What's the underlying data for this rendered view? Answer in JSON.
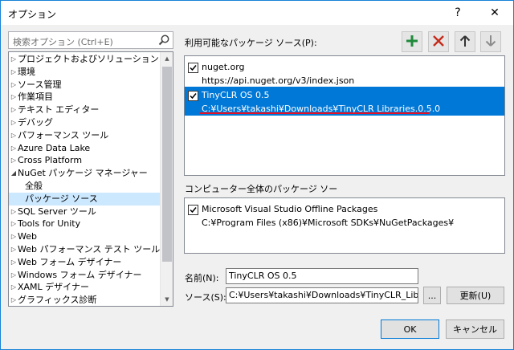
{
  "window": {
    "title": "オプション",
    "help_glyph": "?",
    "close_glyph": "✕"
  },
  "search": {
    "placeholder": "検索オプション (Ctrl+E)"
  },
  "tree": {
    "items": [
      {
        "label": "プロジェクトおよびソリューション",
        "arrow": "▷",
        "child": false,
        "selected": false
      },
      {
        "label": "環境",
        "arrow": "▷",
        "child": false,
        "selected": false
      },
      {
        "label": "ソース管理",
        "arrow": "▷",
        "child": false,
        "selected": false
      },
      {
        "label": "作業項目",
        "arrow": "▷",
        "child": false,
        "selected": false
      },
      {
        "label": "テキスト エディター",
        "arrow": "▷",
        "child": false,
        "selected": false
      },
      {
        "label": "デバッグ",
        "arrow": "▷",
        "child": false,
        "selected": false
      },
      {
        "label": "パフォーマンス ツール",
        "arrow": "▷",
        "child": false,
        "selected": false
      },
      {
        "label": "Azure Data Lake",
        "arrow": "▷",
        "child": false,
        "selected": false
      },
      {
        "label": "Cross Platform",
        "arrow": "▷",
        "child": false,
        "selected": false
      },
      {
        "label": "NuGet パッケージ マネージャー",
        "arrow": "◢",
        "child": false,
        "selected": false
      },
      {
        "label": "全般",
        "arrow": "",
        "child": true,
        "selected": false
      },
      {
        "label": "パッケージ ソース",
        "arrow": "",
        "child": true,
        "selected": true
      },
      {
        "label": "SQL Server ツール",
        "arrow": "▷",
        "child": false,
        "selected": false
      },
      {
        "label": "Tools for Unity",
        "arrow": "▷",
        "child": false,
        "selected": false
      },
      {
        "label": "Web",
        "arrow": "▷",
        "child": false,
        "selected": false
      },
      {
        "label": "Web パフォーマンス テスト ツール",
        "arrow": "▷",
        "child": false,
        "selected": false
      },
      {
        "label": "Web フォーム デザイナー",
        "arrow": "▷",
        "child": false,
        "selected": false
      },
      {
        "label": "Windows フォーム デザイナー",
        "arrow": "▷",
        "child": false,
        "selected": false
      },
      {
        "label": "XAML デザイナー",
        "arrow": "▷",
        "child": false,
        "selected": false
      },
      {
        "label": "グラフィックス診断",
        "arrow": "▷",
        "child": false,
        "selected": false
      }
    ]
  },
  "sources": {
    "label": "利用可能なパッケージ ソース(P):",
    "toolbar": {
      "add_icon": "plus-icon",
      "remove_icon": "x-icon",
      "up_icon": "arrow-up-icon",
      "down_icon": "arrow-down-icon",
      "add_color": "#1f8a3b",
      "remove_color": "#c42b1c"
    },
    "items": [
      {
        "name": "nuget.org",
        "url": "https://api.nuget.org/v3/index.json",
        "checked": true,
        "selected": false
      },
      {
        "name": "TinyCLR OS 0.5",
        "url": "C:¥Users¥takashi¥Downloads¥TinyCLR Libraries.0.5.0",
        "checked": true,
        "selected": true
      }
    ]
  },
  "machine_sources": {
    "label": "コンピューター全体のパッケージ ソー",
    "items": [
      {
        "name": "Microsoft Visual Studio Offline Packages",
        "url": "C:¥Program Files (x86)¥Microsoft SDKs¥NuGetPackages¥",
        "checked": true
      }
    ]
  },
  "form": {
    "name_label": "名前(N):",
    "name_value": "TinyCLR OS 0.5",
    "source_label": "ソース(S):",
    "source_value": "C:¥Users¥takashi¥Downloads¥TinyCLR_Librar",
    "browse_label": "...",
    "update_label": "更新(U)"
  },
  "footer": {
    "ok_label": "OK",
    "cancel_label": "キャンセル"
  },
  "colors": {
    "accent": "#0078d7",
    "tree_selected": "#cce8ff",
    "underline": "#e81123"
  }
}
